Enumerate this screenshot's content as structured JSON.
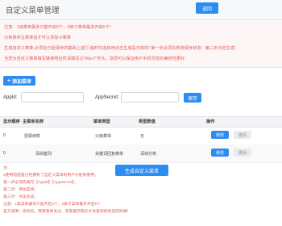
{
  "header": {
    "title": "自定义菜单管理",
    "back_label": "返回"
  },
  "notice": {
    "lines": [
      "注意：1级菜单最多只能开启3个，2级子菜单最多开启5个!",
      "只有保存主菜单后才可以添加子菜单",
      "生成自定义菜单,必须在已经保存的基础上进行,临时勾选启用点击生成是无效的! 第一步必须先修改保存状态！第二步点击生成!",
      "当您为自定义菜单填写链接地址时请填写以\"http://\"开头，这样可以保证用户手机浏览的兼容性更好"
    ]
  },
  "actions": {
    "add_label": "添加菜单",
    "generate_label": "生成自定义菜单",
    "save_label": "保存"
  },
  "form": {
    "appid_label": "AppId:",
    "appsecret_label": "AppSecret:",
    "appid_value": "",
    "appsecret_value": ""
  },
  "table": {
    "headers": [
      "显示顺序",
      "主菜单名称",
      "菜单类型",
      "类型数值",
      "操作"
    ],
    "rows": [
      {
        "order": "0",
        "name": "招贤纳校",
        "type": "父级菜单",
        "value": "无",
        "edit": "修改",
        "delete": "删除"
      },
      {
        "order": "0",
        "name": "深圳基列",
        "type": "关键词回复菜单",
        "value": "深圳分校",
        "edit": "修改",
        "delete": "删除"
      }
    ]
  },
  "notes": {
    "lines": [
      "注：",
      "1使用前提是已经拥有了自定义菜单的用户才能够使用；",
      "第一步必须先填写【AppId】【AppSecret】；",
      "第二步：添加菜单；",
      "第三步：点击生成；",
      "注意：1级菜单最多只能开启3个，2级子菜单最多开启5个",
      "官方说明：修改后，需要重新关注，或者最迟隔天才会看到修改后的效果！"
    ]
  },
  "colors": {
    "accent": "#2d8cf0",
    "warning_text": "#e25a5a"
  }
}
